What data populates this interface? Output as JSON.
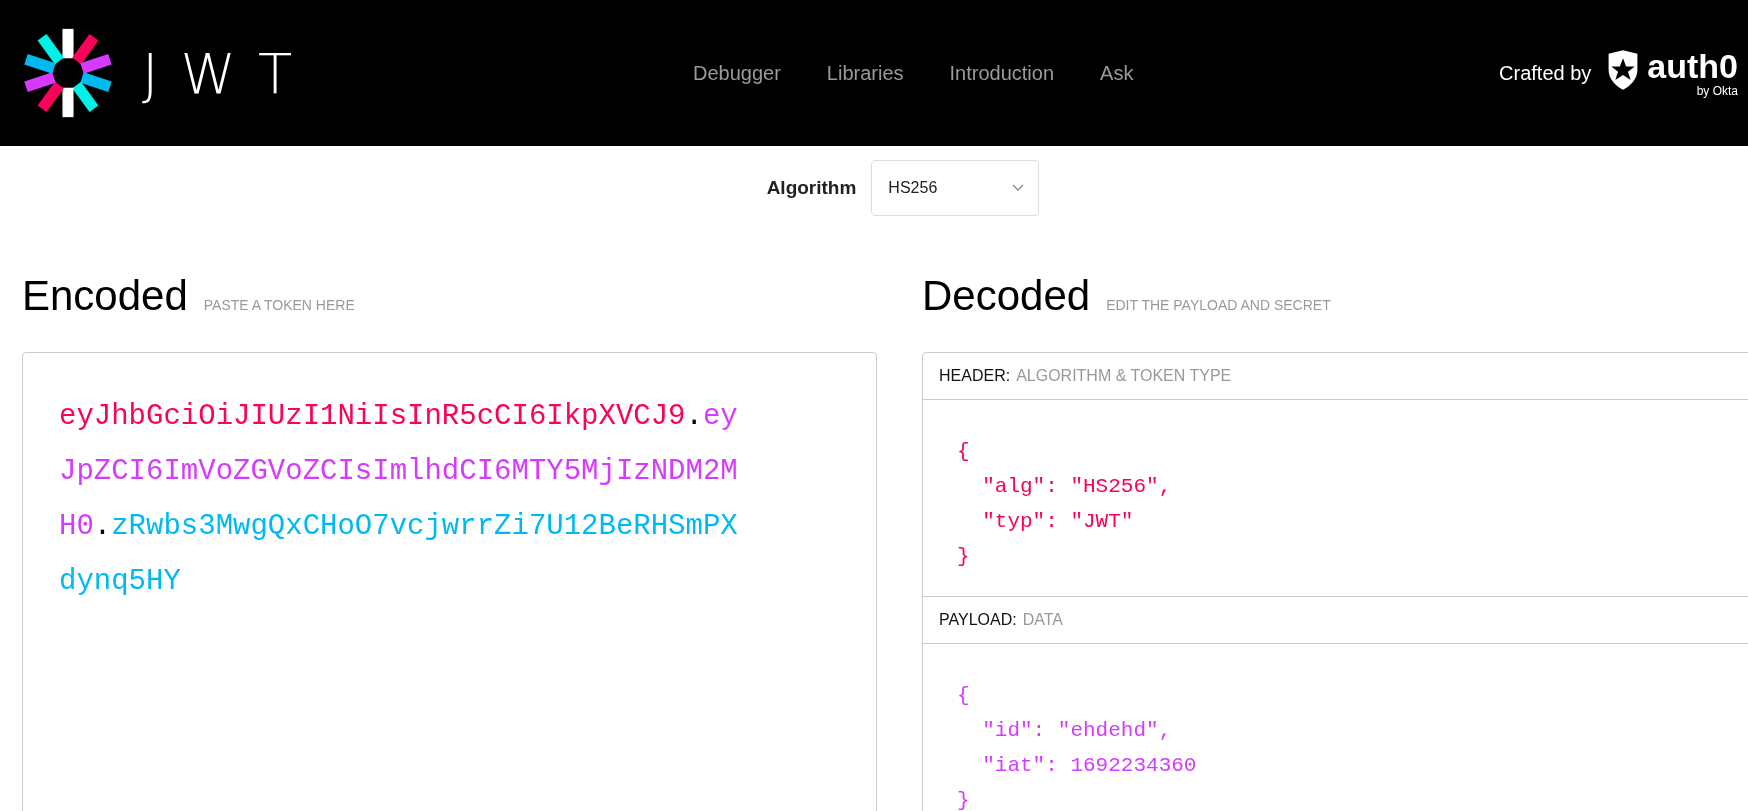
{
  "brand": {
    "wordmark": "JWT"
  },
  "nav": [
    {
      "label": "Debugger"
    },
    {
      "label": "Libraries"
    },
    {
      "label": "Introduction"
    },
    {
      "label": "Ask"
    }
  ],
  "credit": {
    "label": "Crafted by",
    "logo_text": "auth0",
    "logo_sub": "by Okta"
  },
  "algorithm": {
    "label": "Algorithm",
    "value": "HS256"
  },
  "encoded": {
    "title": "Encoded",
    "hint": "PASTE A TOKEN HERE",
    "token": [
      {
        "kind": "header",
        "text": "eyJhbGciOiJIUzI1NiIsInR5cCI6IkpXVCJ9"
      },
      {
        "kind": "dot",
        "text": "."
      },
      {
        "kind": "payload",
        "text": "eyJpZCI6ImVoZGVoZCIsImlhdCI6MTY5MjIzNDM2MH0"
      },
      {
        "kind": "dot",
        "text": "."
      },
      {
        "kind": "signature",
        "text": "zRwbs3MwgQxCHoO7vcjwrrZi7U12BeRHSmPXdynq5HY"
      }
    ]
  },
  "decoded": {
    "title": "Decoded",
    "hint": "EDIT THE PAYLOAD AND SECRET",
    "sections": [
      {
        "kind": "header",
        "label": "HEADER:",
        "sublabel": "ALGORITHM & TOKEN TYPE",
        "lines": [
          "{",
          "  \"alg\": \"HS256\",",
          "  \"typ\": \"JWT\"",
          "}"
        ]
      },
      {
        "kind": "payload",
        "label": "PAYLOAD:",
        "sublabel": "DATA",
        "lines": [
          "{",
          "  \"id\": \"ehdehd\",",
          "  \"iat\": 1692234360",
          "}"
        ]
      }
    ]
  }
}
